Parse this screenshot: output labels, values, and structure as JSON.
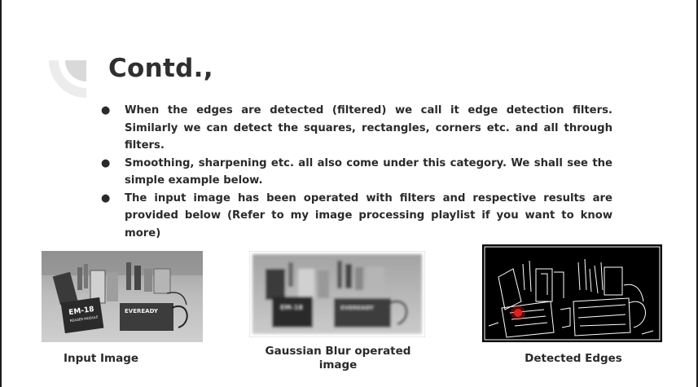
{
  "slide": {
    "title": "Contd.,",
    "bullets": [
      "When the edges are detected (filtered) we call it edge detection filters. Similarly we can detect the squares, rectangles, corners etc. and all through filters.",
      "Smoothing, sharpening etc. all also come under this category. We shall see the simple example below.",
      "The input image has been operated with filters and respective results are provided below (Refer to my image processing playlist if you want to know more)"
    ],
    "bullet_symbol": "●",
    "figures": [
      {
        "caption": "Input Image",
        "label_module": "EM-18",
        "label_module_sub": "READER MODULE",
        "label_battery": "EVEREADY"
      },
      {
        "caption": "Gaussian Blur operated image",
        "label_module": "EM-18",
        "label_battery": "EVEREADY"
      },
      {
        "caption": "Detected Edges"
      }
    ],
    "colors": {
      "title": "#2f2f2f",
      "text": "#2a2a2a",
      "accent_grey": "#d9d9d9",
      "edge_bg": "#000000",
      "marker": "#e02020"
    }
  }
}
